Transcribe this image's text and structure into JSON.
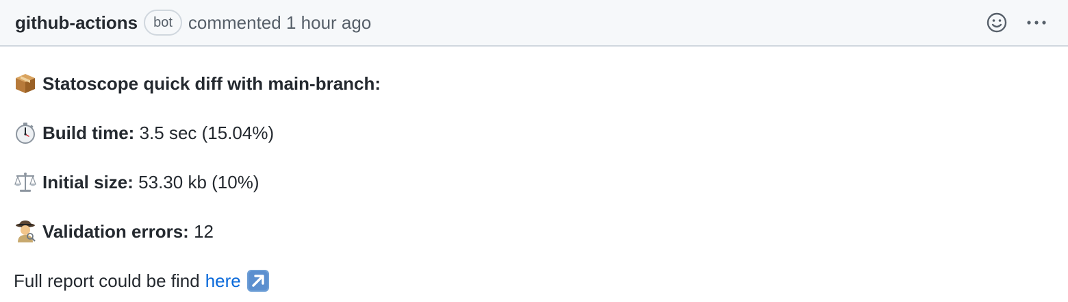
{
  "comment": {
    "author": "github-actions",
    "badge": "bot",
    "action": "commented",
    "time": "1 hour ago",
    "icons": {
      "reaction": "smiley-icon",
      "menu": "kebab-horizontal-icon"
    }
  },
  "body": {
    "heading": {
      "icon": "package-icon",
      "label": "Statoscope quick diff with main-branch:"
    },
    "build_time": {
      "icon": "stopwatch-icon",
      "label": "Build time:",
      "value": "3.5 sec (15.04%)"
    },
    "initial_size": {
      "icon": "balance-scale-icon",
      "label": "Initial size:",
      "value": "53.30 kb (10%)"
    },
    "validation_errors": {
      "icon": "detective-icon",
      "label": "Validation errors:",
      "value": "12"
    },
    "report": {
      "text": "Full report could be find",
      "link_text": "here",
      "link_icon": "up-right-arrow-icon"
    }
  },
  "colors": {
    "header_bg": "#f6f8fa",
    "border": "#d0d7de",
    "link": "#0969da",
    "muted": "#57606a"
  }
}
